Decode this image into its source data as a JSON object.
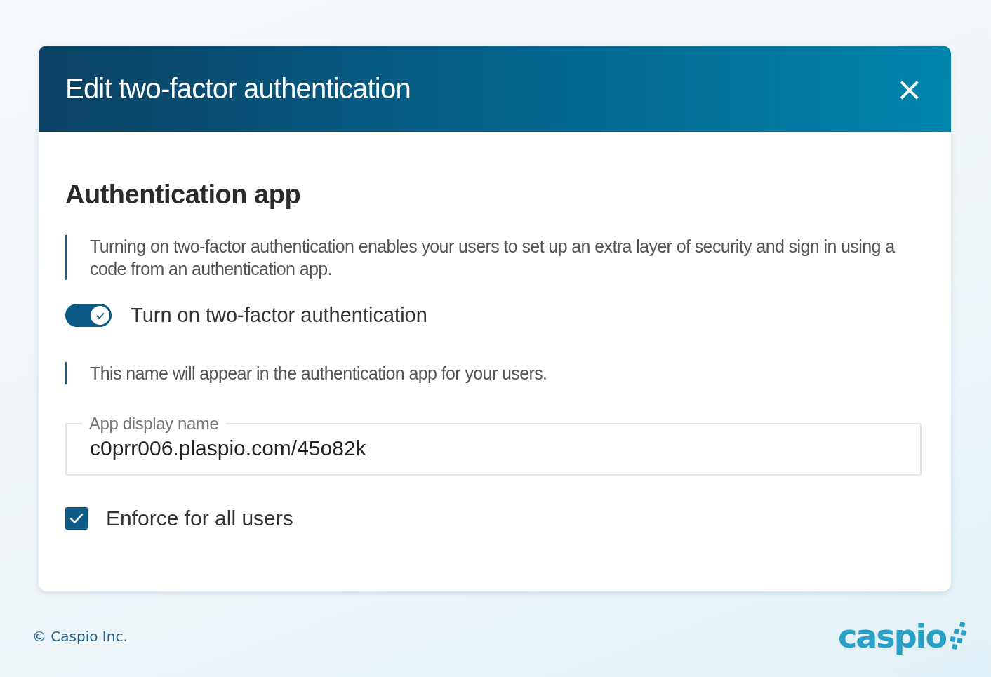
{
  "dialog": {
    "title": "Edit two-factor authentication",
    "close_label": "×"
  },
  "section": {
    "heading": "Authentication app",
    "description": "Turning on two-factor authentication enables your users to set up an extra layer of security and sign in using a code from an authentication app."
  },
  "toggle": {
    "label": "Turn on two-factor authentication",
    "on": true
  },
  "name_note": "This name will appear in the authentication app for your users.",
  "field": {
    "label": "App display name",
    "value": "c0prr006.plaspio.com/45o82k"
  },
  "checkbox": {
    "label": "Enforce for all users",
    "checked": true
  },
  "footer": {
    "copyright": "© Caspio Inc.",
    "logo": "caspio"
  }
}
